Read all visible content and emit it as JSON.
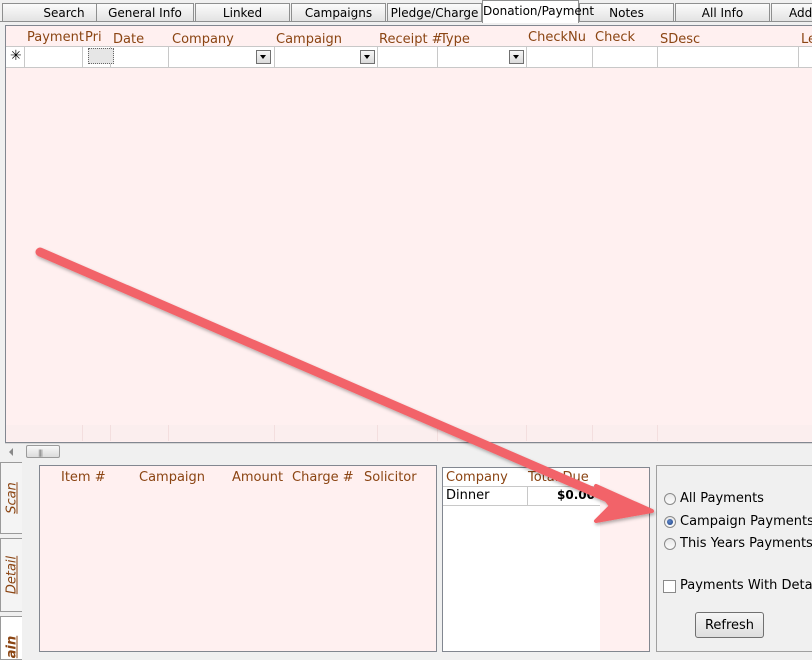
{
  "tabs": [
    {
      "label": "Search",
      "active": false
    },
    {
      "label": "General Info",
      "active": false
    },
    {
      "label": "Linked",
      "active": false
    },
    {
      "label": "Campaigns",
      "active": false
    },
    {
      "label": "Pledge/Charge",
      "active": false
    },
    {
      "label": "Donation/Payment",
      "active": true
    },
    {
      "label": "Notes",
      "active": false
    },
    {
      "label": "All Info",
      "active": false
    },
    {
      "label": "Addi",
      "active": false
    }
  ],
  "main_grid": {
    "columns": [
      "Payment",
      "Pri",
      "Date",
      "Company",
      "Campaign",
      "Receipt #",
      "Type",
      "CheckNu",
      "Check",
      "SDesc",
      "Le"
    ],
    "new_row_marker": "✳"
  },
  "side_tabs": [
    "Scan",
    "Detail",
    "ain"
  ],
  "item_grid": {
    "columns": [
      "Item #",
      "Campaign",
      "Amount",
      "Charge #",
      "Solicitor"
    ]
  },
  "company_grid": {
    "columns": [
      "Company",
      "Total Due"
    ],
    "rows": [
      {
        "company": "Dinner",
        "total_due": "$0.00"
      }
    ]
  },
  "options": {
    "radios": [
      {
        "label": "All Payments",
        "checked": false
      },
      {
        "label": "Campaign Payments",
        "checked": true
      },
      {
        "label": "This Years Payments",
        "checked": false
      }
    ],
    "checkbox": {
      "label": "Payments With Detail",
      "checked": false
    },
    "refresh_label": "Refresh"
  },
  "colors": {
    "grid_background": "#fff0f0",
    "header_text": "#8b4513",
    "arrow": "#f26469"
  }
}
